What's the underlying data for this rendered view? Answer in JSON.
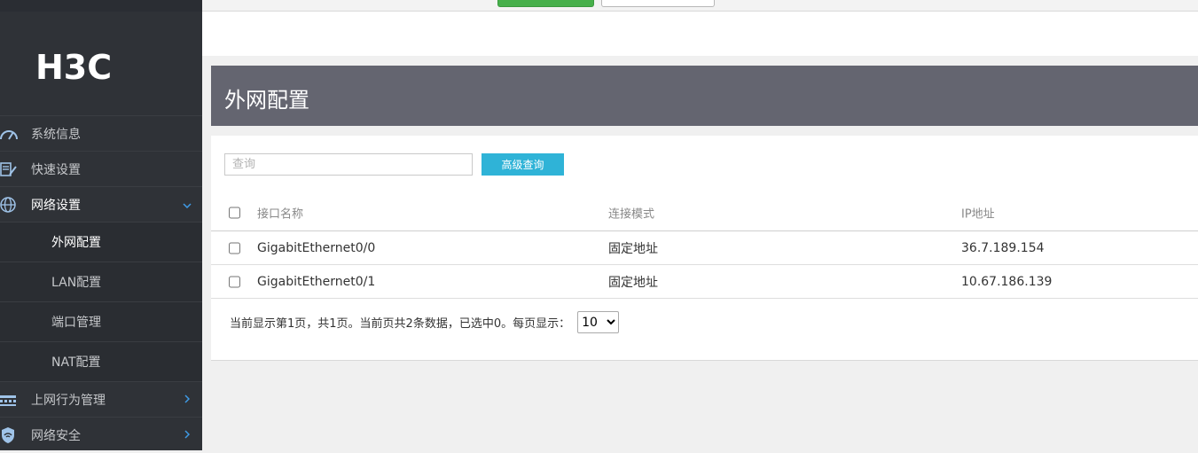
{
  "brand": {
    "logo_text": "H3C"
  },
  "sidebar": {
    "items": [
      {
        "label": "系统信息",
        "icon": "dashboard-gauge-icon"
      },
      {
        "label": "快速设置",
        "icon": "quick-setup-icon"
      },
      {
        "label": "网络设置",
        "icon": "globe-icon",
        "expanded": true
      },
      {
        "label": "上网行为管理",
        "icon": "behavior-management-icon"
      },
      {
        "label": "网络安全",
        "icon": "shield-wifi-icon"
      }
    ],
    "sub_items": [
      {
        "label": "外网配置",
        "selected": true
      },
      {
        "label": "LAN配置"
      },
      {
        "label": "端口管理"
      },
      {
        "label": "NAT配置"
      }
    ]
  },
  "page": {
    "title": "外网配置"
  },
  "search": {
    "placeholder": "查询",
    "advanced_button": "高级查询"
  },
  "table": {
    "columns": [
      "接口名称",
      "连接模式",
      "IP地址"
    ],
    "rows": [
      {
        "interface": "GigabitEthernet0/0",
        "mode": "固定地址",
        "ip": "36.7.189.154"
      },
      {
        "interface": "GigabitEthernet0/1",
        "mode": "固定地址",
        "ip": "10.67.186.139"
      }
    ]
  },
  "pager": {
    "summary": "当前显示第1页，共1页。当前页共2条数据，已选中0。每页显示：",
    "page_size": "10",
    "page_size_options": [
      "10"
    ]
  },
  "colors": {
    "sidebar_bg": "#2f3237",
    "header_bg": "#646570",
    "accent_button": "#2fb3d7",
    "chevron": "#3f9be6"
  }
}
